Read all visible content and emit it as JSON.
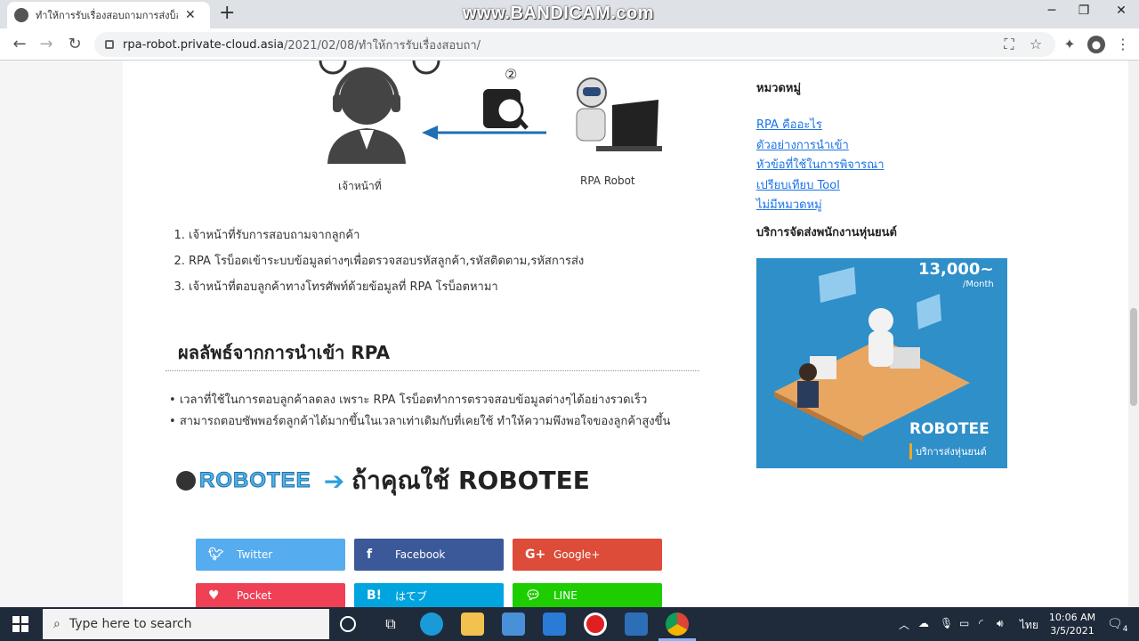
{
  "browser": {
    "tab_title": "ทำให้การรับเรื่องสอบถามการส่งบ็อต AI",
    "watermark": "www.BANDICAM.com",
    "url_host": "rpa-robot.private-cloud.asia",
    "url_path": "/2021/02/08/ทำให้การรับเรื่องสอบถา/"
  },
  "article": {
    "diagram": {
      "step_marker": "②",
      "agent_label": "เจ้าหน้าที่",
      "robot_label": "RPA Robot"
    },
    "steps": [
      "เจ้าหน้าที่รับการสอบถามจากลูกค้า",
      "RPA โรบ็อตเข้าระบบข้อมูลต่างๆเพื่อตรวจสอบรหัสลูกค้า,รหัสติดตาม,รหัสการส่ง",
      "เจ้าหน้าที่ตอบลูกค้าทางโทรศัพท์ด้วยข้อมูลที่ RPA โรบ็อตหามา"
    ],
    "results_heading": "ผลลัพธ์จากการนำเข้า RPA",
    "results": [
      "เวลาที่ใช้ในการตอบลูกค้าลดลง เพราะ RPA โรบ็อตทำการตรวจสอบข้อมูลต่างๆได้อย่างรวดเร็ว",
      "สามารถตอบซัพพอร์ตลูกค้าได้มากขึ้นในเวลาเท่าเดิมกับที่เคยใช้ ทำให้ความพึงพอใจของลูกค้าสูงขึ้น"
    ],
    "brand_logo": "ROBOTEE",
    "brand_tagline": "ถ้าคุณใช้ ROBOTEE",
    "share": {
      "twitter": "Twitter",
      "facebook": "Facebook",
      "google": "Google+",
      "pocket": "Pocket",
      "hatena": "はてブ",
      "line": "LINE"
    },
    "colors": {
      "twitter": "#55acee",
      "facebook": "#3b5998",
      "google": "#dd4b39",
      "pocket": "#ef4056",
      "hatena": "#00a4de",
      "line": "#1dcd00"
    }
  },
  "sidebar": {
    "categories_heading": "หมวดหมู่",
    "categories": [
      "RPA คืออะไร",
      "ตัวอย่างการนำเข้า",
      "หัวข้อที่ใช้ในการพิจารณา",
      "เปรียบเทียบ Tool",
      "ไม่มีหมวดหมู่"
    ],
    "service_heading": "บริการจัดส่งพนักงานหุ่นยนต์",
    "ad_price": "13,000~",
    "ad_period": "/Month",
    "ad_brand": "ROBOTEE",
    "ad_caption": "บริการส่งหุ่นยนต์"
  },
  "taskbar": {
    "search_placeholder": "Type here to search",
    "language": "ไทย",
    "time": "10:06 AM",
    "date": "3/5/2021",
    "notification_count": "4"
  }
}
